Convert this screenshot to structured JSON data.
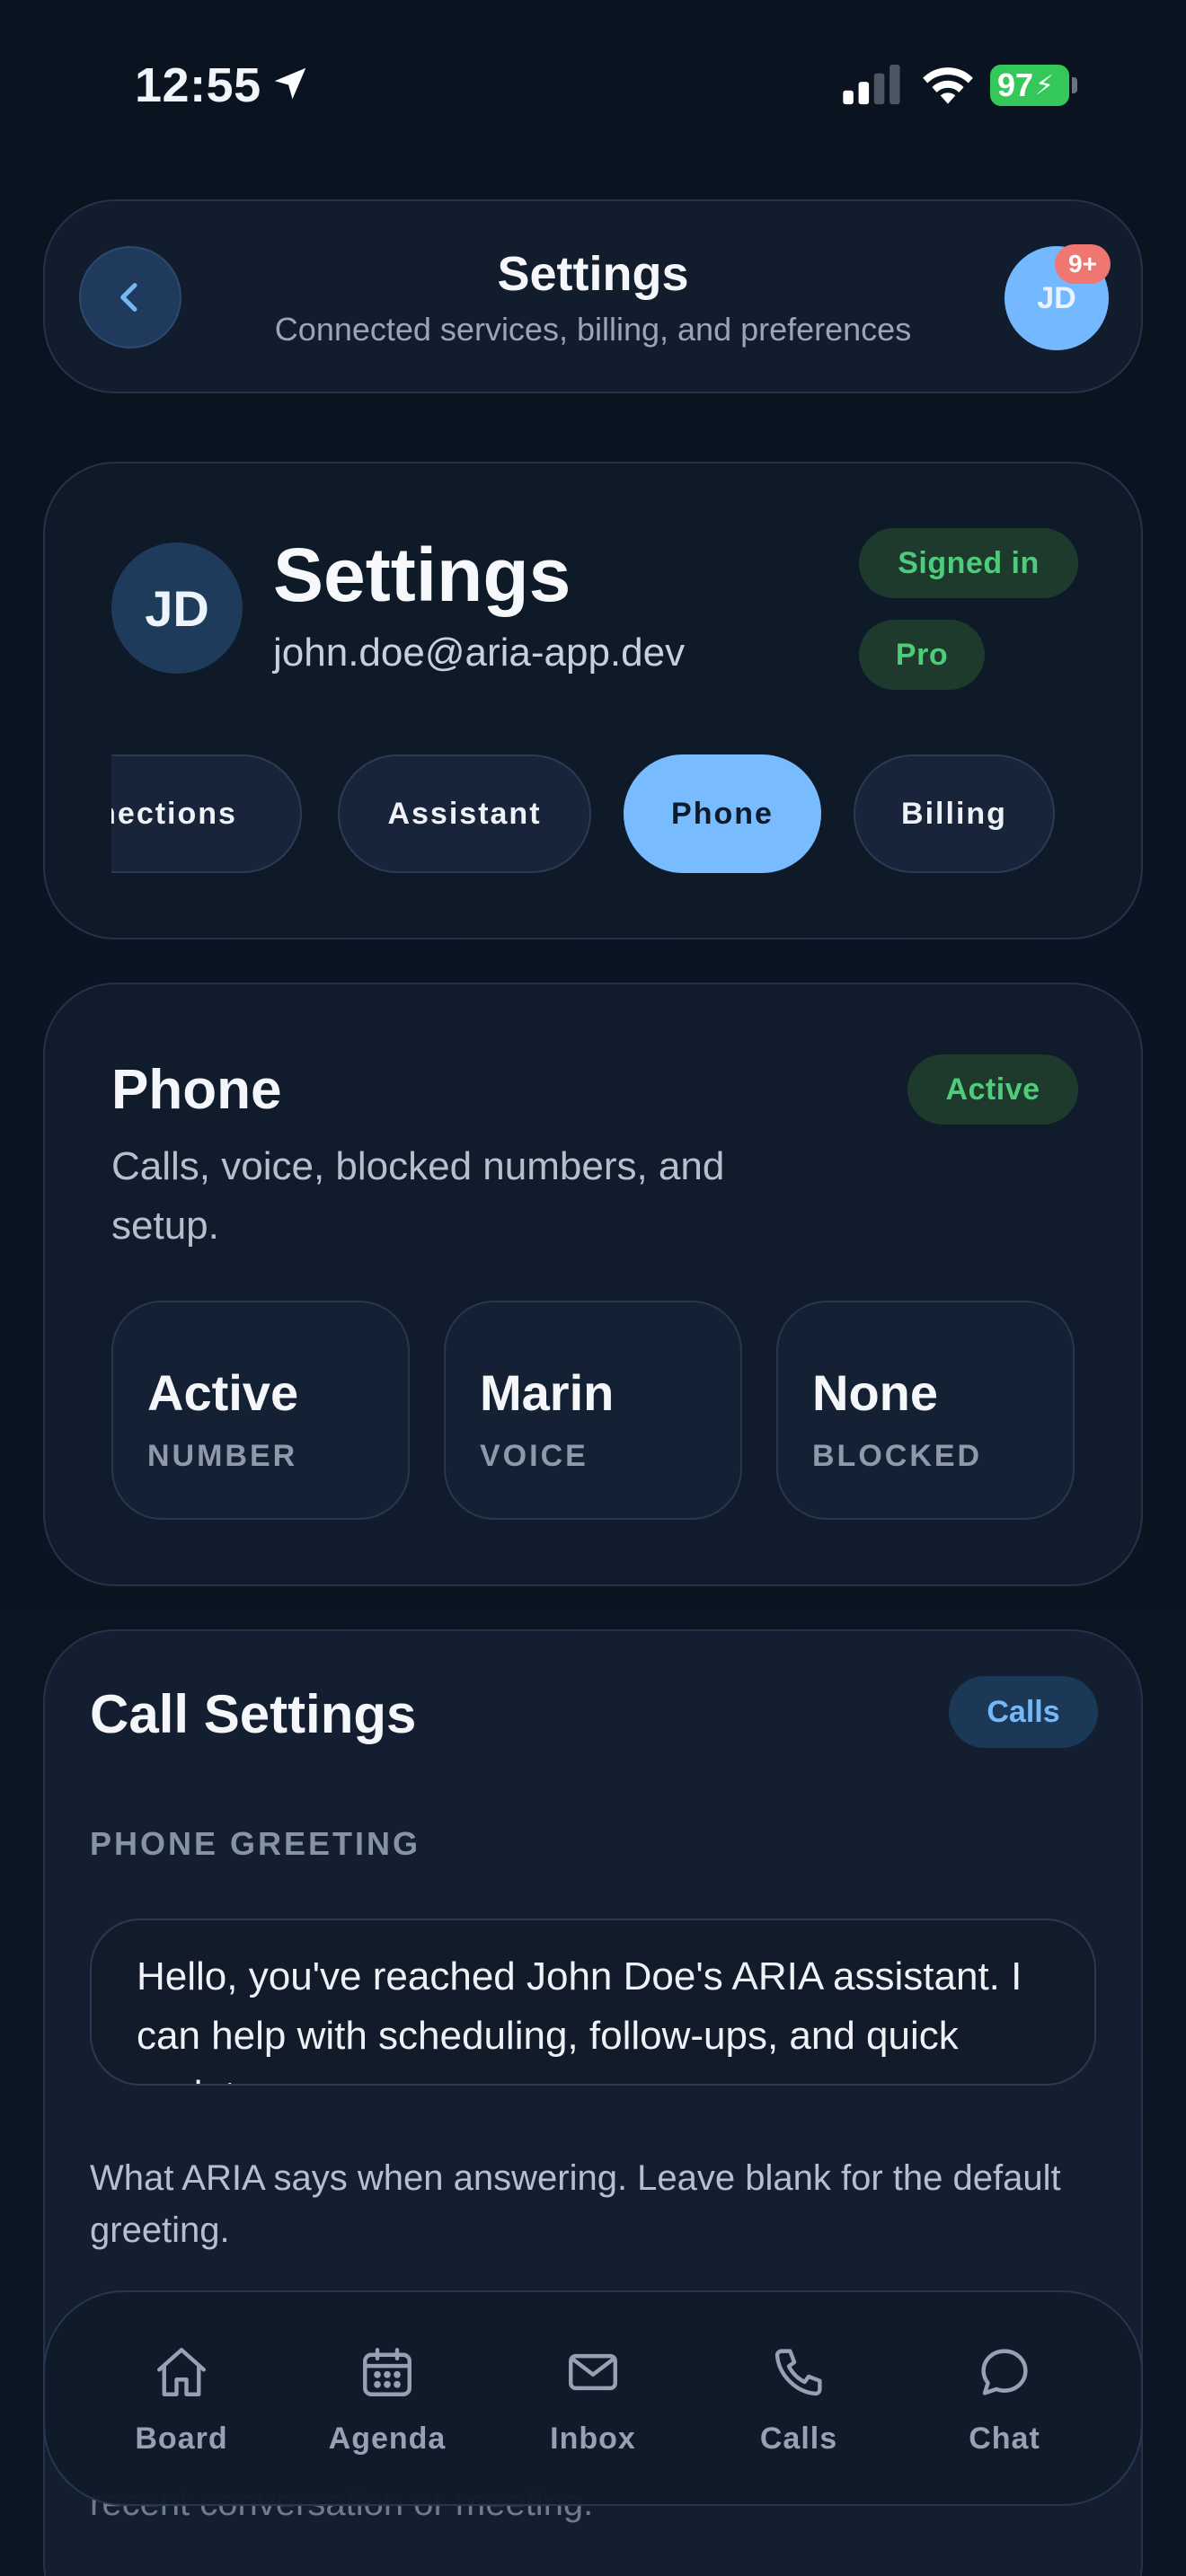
{
  "status_bar": {
    "time": "12:55",
    "battery": "97"
  },
  "header": {
    "title": "Settings",
    "subtitle": "Connected services, billing, and preferences",
    "avatar_initials": "JD",
    "notification_count": "9+"
  },
  "profile": {
    "initials": "JD",
    "title": "Settings",
    "email": "john.doe@aria-app.dev",
    "badges": {
      "signed_in": "Signed in",
      "plan": "Pro"
    },
    "tabs": [
      {
        "label": "Connections",
        "active": false
      },
      {
        "label": "Assistant",
        "active": false
      },
      {
        "label": "Phone",
        "active": true
      },
      {
        "label": "Billing",
        "active": false
      }
    ]
  },
  "phone": {
    "title": "Phone",
    "description": "Calls, voice, blocked numbers, and setup.",
    "status": "Active",
    "stats": [
      {
        "value": "Active",
        "label": "NUMBER"
      },
      {
        "value": "Marin",
        "label": "VOICE"
      },
      {
        "value": "None",
        "label": "BLOCKED"
      }
    ]
  },
  "call_settings": {
    "title": "Call Settings",
    "badge": "Calls",
    "greeting_label": "PHONE GREETING",
    "greeting_value": "Hello, you've reached John Doe's ARIA assistant. I can help with scheduling, follow-ups, and quick updates.",
    "greeting_help": "What ARIA says when answering. Leave blank for the default greeting.",
    "next_help_partial": "recent conversation or meeting."
  },
  "bottom_nav": [
    {
      "label": "Board",
      "icon": "home-icon"
    },
    {
      "label": "Agenda",
      "icon": "calendar-icon"
    },
    {
      "label": "Inbox",
      "icon": "mail-icon"
    },
    {
      "label": "Calls",
      "icon": "phone-icon"
    },
    {
      "label": "Chat",
      "icon": "chat-bubble-icon"
    }
  ],
  "colors": {
    "accent": "#78bcff",
    "success": "#4ecb7b",
    "badge_red": "#f07672",
    "background": "#0b1320"
  }
}
